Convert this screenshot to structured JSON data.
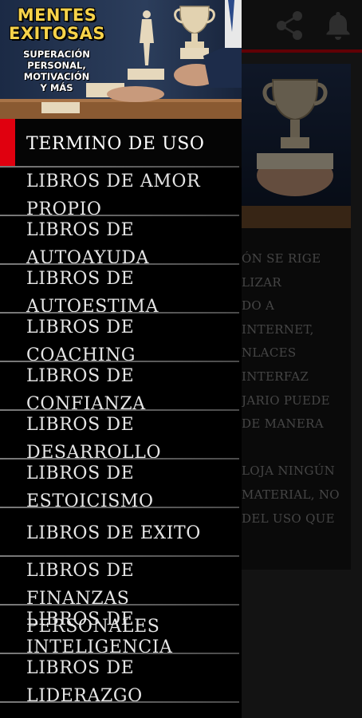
{
  "background": {
    "share_icon": "share-icon",
    "bell_icon": "bell-icon",
    "body_text": "ÓN SE RIGE\nLIZAR\nDO A\nINTERNET,\nNLACES\nINTERFAZ\nJARIO PUEDE\nDE MANERA\n\nLOJA NINGÚN\nMATERIAL, NO\nDEL USO QUE",
    "accent_color": "#c2000b"
  },
  "drawer": {
    "brand": {
      "title": "MENTES\nEXITOSAS",
      "subtitle": "SUPERACIÓN\nPERSONAL,\nMOTIVACIÓN\nY MÁS"
    },
    "items": [
      {
        "label": "TERMINO DE USO",
        "active": true
      },
      {
        "label": "LIBROS DE AMOR\nPROPIO"
      },
      {
        "label": "LIBROS DE\nAUTOAYUDA"
      },
      {
        "label": "LIBROS DE\nAUTOESTIMA"
      },
      {
        "label": "LIBROS DE\nCOACHING"
      },
      {
        "label": "LIBROS DE\nCONFIANZA"
      },
      {
        "label": "LIBROS DE\nDESARROLLO"
      },
      {
        "label": "LIBROS DE\nESTOICISMO"
      },
      {
        "label": "LIBROS DE EXITO"
      },
      {
        "label": "LIBROS DE FINANZAS\nPERSONALES"
      },
      {
        "label": "LIBROS DE\nINTELIGENCIA"
      },
      {
        "label": "LIBROS DE\nLIDERAZGO"
      }
    ],
    "active_color": "#e0000f"
  }
}
